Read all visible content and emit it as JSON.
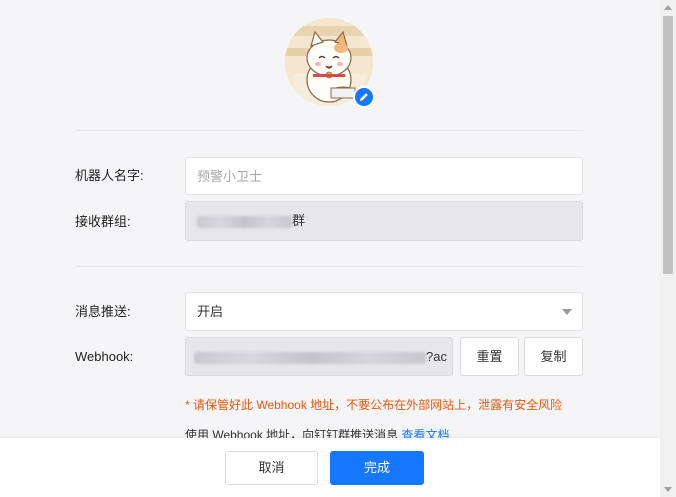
{
  "form": {
    "robot_name_label": "机器人名字:",
    "robot_name_placeholder": "预警小卫士",
    "group_label": "接收群组:",
    "group_value_suffix": "群",
    "push_label": "消息推送:",
    "push_value": "开启",
    "webhook_label": "Webhook:",
    "webhook_value_suffix": "?ac",
    "reset_label": "重置",
    "copy_label": "复制",
    "warning": "* 请保管好此 Webhook 地址，不要公布在外部网站上，泄露有安全风险",
    "hint_text": "使用 Webhook 地址，向钉钉群推送消息",
    "hint_link": "查看文档"
  },
  "footer": {
    "cancel_label": "取消",
    "done_label": "完成"
  },
  "colors": {
    "primary": "#1677ff",
    "warning": "#e8590c"
  },
  "icons": {
    "avatar": "cat-avatar",
    "edit": "pencil-icon",
    "dropdown": "caret-down-icon"
  }
}
